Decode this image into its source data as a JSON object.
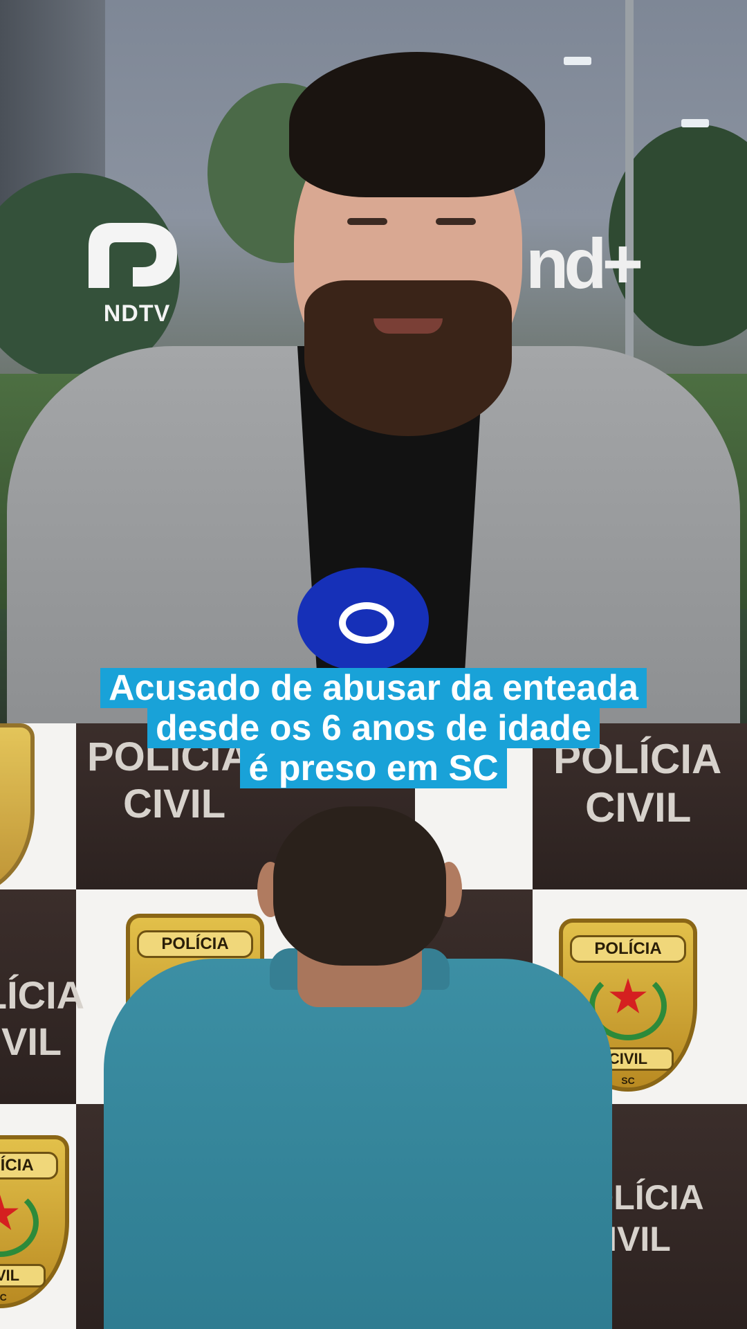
{
  "logos": {
    "ndtv_label": "NDTV",
    "ndplus_label": "nd+"
  },
  "caption": {
    "lines": [
      "Acusado de abusar da enteada",
      "desde os 6 anos de idade",
      "é preso em SC"
    ]
  },
  "backdrop": {
    "wall_word_1": "POLÍCIA",
    "wall_word_2": "CIVIL",
    "badge_top": "POLÍCIA",
    "badge_bottom": "CIVIL",
    "badge_state": "SC"
  },
  "colors": {
    "caption_background": "#19a2d8",
    "caption_text": "#ffffff",
    "logo_color": "#f4f4f4"
  }
}
